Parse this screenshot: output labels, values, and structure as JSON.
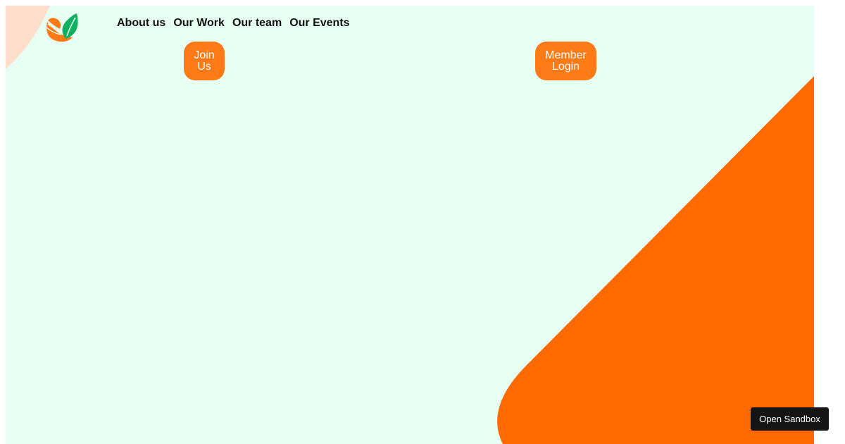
{
  "nav": {
    "items": [
      {
        "label": "About us"
      },
      {
        "label": "Our Work"
      },
      {
        "label": "Our team"
      },
      {
        "label": "Our Events"
      }
    ]
  },
  "actions": {
    "join_label_line1": "Join",
    "join_label_line2": "Us",
    "login_label_line1": "Member",
    "login_label_line2": "Login"
  },
  "sandbox": {
    "label": "Open Sandbox"
  },
  "colors": {
    "page_background": "#e6fff2",
    "accent_orange": "#fd7a16",
    "shape_orange": "#ff6a00",
    "corner_peach": "#ffdfcc",
    "logo_green": "#10b060",
    "sandbox_bg": "#151515"
  },
  "icons": {
    "logo": "leaf-hands-logo-icon"
  }
}
